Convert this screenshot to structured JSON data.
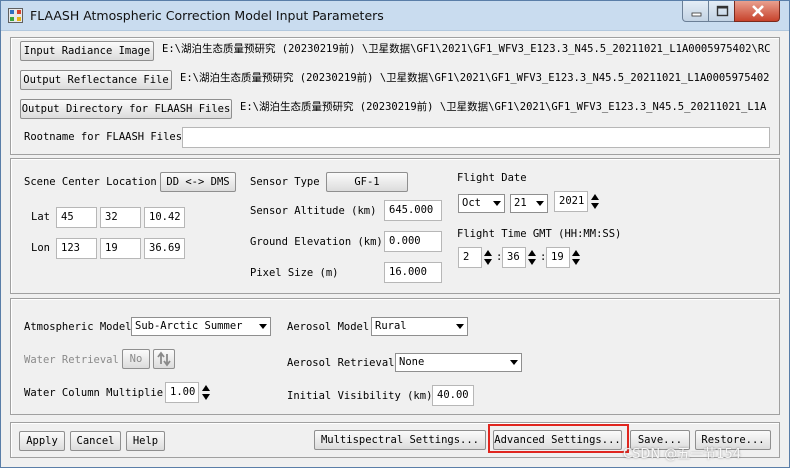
{
  "window": {
    "title": "FLAASH Atmospheric Correction Model Input Parameters"
  },
  "files": {
    "input_radiance_label": "Input Radiance Image",
    "input_radiance_path": "E:\\湖泊生态质量预研究 (20230219前) \\卫星数据\\GF1\\2021\\GF1_WFV3_E123.3_N45.5_20211021_L1A0005975402\\RC",
    "output_reflectance_label": "Output Reflectance File",
    "output_reflectance_path": "E:\\湖泊生态质量预研究 (20230219前) \\卫星数据\\GF1\\2021\\GF1_WFV3_E123.3_N45.5_20211021_L1A0005975402",
    "output_directory_label": "Output Directory for FLAASH Files",
    "output_directory_path": "E:\\湖泊生态质量预研究 (20230219前) \\卫星数据\\GF1\\2021\\GF1_WFV3_E123.3_N45.5_20211021_L1A",
    "rootname_label": "Rootname for FLAASH Files",
    "rootname_value": ""
  },
  "scene": {
    "center_label": "Scene Center Location",
    "dd_dms_button": "DD <-> DMS",
    "lat_label": "Lat",
    "lat_deg": "45",
    "lat_min": "32",
    "lat_sec": "10.42",
    "lon_label": "Lon",
    "lon_deg": "123",
    "lon_min": "19",
    "lon_sec": "36.69"
  },
  "sensor": {
    "type_label": "Sensor Type",
    "type_value": "GF-1",
    "altitude_label": "Sensor Altitude (km)",
    "altitude_value": "645.000",
    "ground_label": "Ground Elevation (km)",
    "ground_value": "0.000",
    "pixel_label": "Pixel Size (m)",
    "pixel_value": "16.000"
  },
  "flight": {
    "date_label": "Flight Date",
    "month": "Oct",
    "day": "21",
    "year": "2021",
    "time_label": "Flight Time GMT (HH:MM:SS)",
    "hh": "2",
    "mm": "36",
    "ss": "19",
    "sep": ":"
  },
  "atmosphere": {
    "model_label": "Atmospheric Model",
    "model_value": "Sub-Arctic Summer",
    "water_retrieval_label": "Water Retrieval",
    "water_retrieval_value": "No",
    "water_multiplier_label": "Water Column Multiplier",
    "water_multiplier_value": "1.00"
  },
  "aerosol": {
    "model_label": "Aerosol Model",
    "model_value": "Rural",
    "retrieval_label": "Aerosol Retrieval",
    "retrieval_value": "None",
    "visibility_label": "Initial Visibility (km)",
    "visibility_value": "40.00"
  },
  "buttons": {
    "apply": "Apply",
    "cancel": "Cancel",
    "help": "Help",
    "multispectral": "Multispectral Settings...",
    "advanced": "Advanced Settings...",
    "save": "Save...",
    "restore": "Restore..."
  },
  "watermark": "CSDN @五一节154",
  "colors": {
    "highlight": "#e0261f",
    "titlebar": "#c9dcef",
    "close_button": "#c7432c"
  }
}
